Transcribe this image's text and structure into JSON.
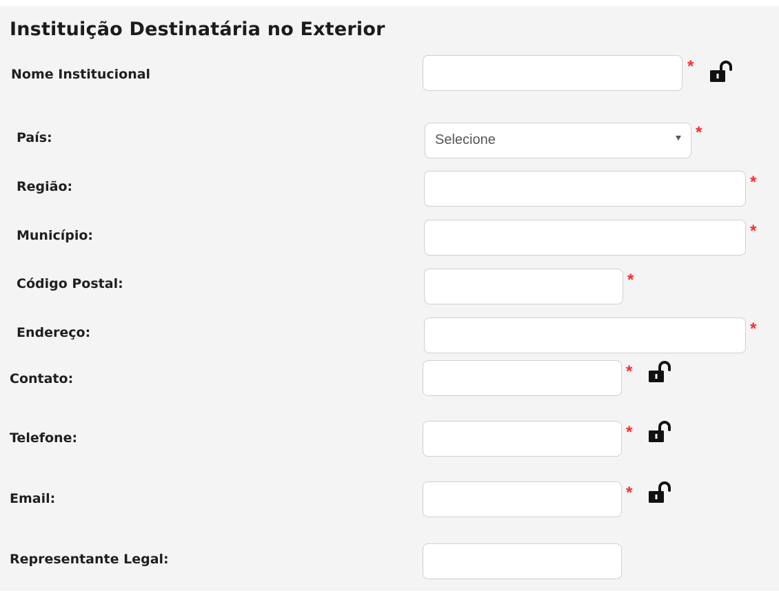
{
  "form": {
    "title": "Instituição Destinatária no Exterior",
    "required_mark": "*",
    "fields": {
      "nome_institucional": {
        "label": "Nome Institucional",
        "value": "",
        "required": true,
        "lock_icon": "unlocked-padlock-icon"
      },
      "pais": {
        "label": "País:",
        "selected": "Selecione",
        "required": true
      },
      "regiao": {
        "label": "Região:",
        "value": "",
        "required": true
      },
      "municipio": {
        "label": "Município:",
        "value": "",
        "required": true
      },
      "codigo_postal": {
        "label": "Código Postal:",
        "value": "",
        "required": true
      },
      "endereco": {
        "label": "Endereço:",
        "value": "",
        "required": true
      },
      "contato": {
        "label": "Contato:",
        "value": "",
        "required": true,
        "lock_icon": "unlocked-padlock-icon"
      },
      "telefone": {
        "label": "Telefone:",
        "value": "",
        "required": true,
        "lock_icon": "unlocked-padlock-icon"
      },
      "email": {
        "label": "Email:",
        "value": "",
        "required": true,
        "lock_icon": "unlocked-padlock-icon"
      },
      "representante_legal": {
        "label": "Representante Legal:",
        "value": "",
        "required": false
      }
    }
  },
  "colors": {
    "panel_background": "#f4f4f4",
    "required_mark": "#ff2a2a",
    "input_border": "#cfcfcf",
    "text": "#1f1f1f"
  }
}
